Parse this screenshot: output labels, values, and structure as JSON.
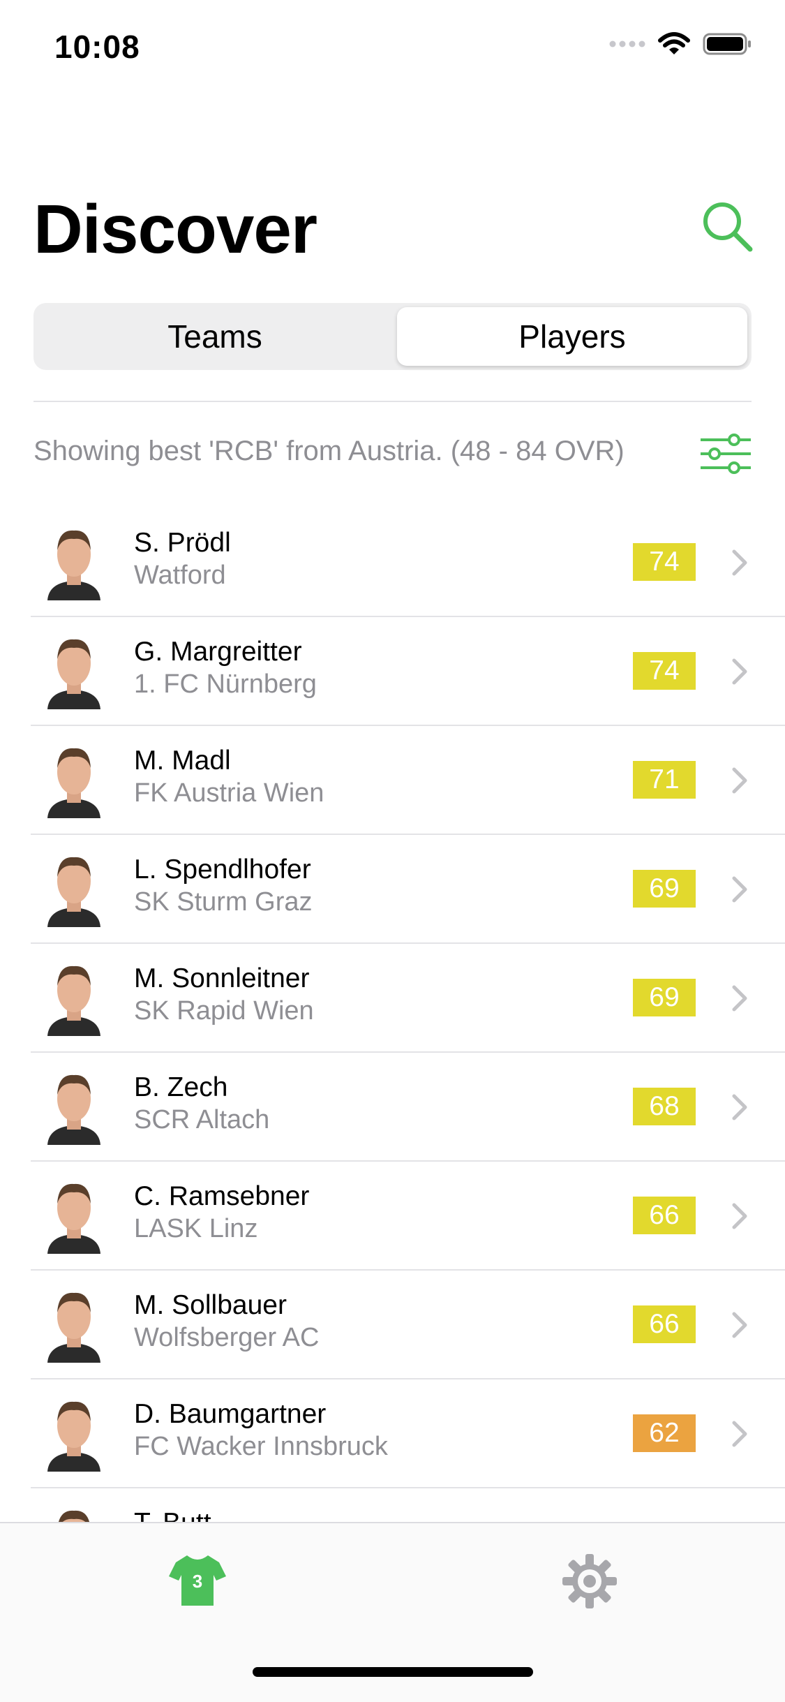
{
  "status_bar": {
    "time": "10:08",
    "icons": [
      "signal-dots-icon",
      "wifi-icon",
      "battery-icon"
    ]
  },
  "header": {
    "title": "Discover",
    "search_icon": "search-icon"
  },
  "segments": {
    "items": [
      "Teams",
      "Players"
    ],
    "selected": "Players"
  },
  "filter": {
    "text": "Showing best 'RCB' from Austria. (48 - 84 OVR)",
    "icon": "sliders-icon"
  },
  "players": [
    {
      "name": "S. Prödl",
      "club": "Watford",
      "rating": "74",
      "rating_color": "#e2d92d"
    },
    {
      "name": "G. Margreitter",
      "club": "1. FC Nürnberg",
      "rating": "74",
      "rating_color": "#e2d92d"
    },
    {
      "name": "M. Madl",
      "club": "FK Austria Wien",
      "rating": "71",
      "rating_color": "#e2d92d"
    },
    {
      "name": "L. Spendlhofer",
      "club": "SK Sturm Graz",
      "rating": "69",
      "rating_color": "#e2d92d"
    },
    {
      "name": "M. Sonnleitner",
      "club": "SK Rapid Wien",
      "rating": "69",
      "rating_color": "#e2d92d"
    },
    {
      "name": "B. Zech",
      "club": "SCR Altach",
      "rating": "68",
      "rating_color": "#e2d92d"
    },
    {
      "name": "C. Ramsebner",
      "club": "LASK Linz",
      "rating": "66",
      "rating_color": "#e2d92d"
    },
    {
      "name": "M. Sollbauer",
      "club": "Wolfsberger AC",
      "rating": "66",
      "rating_color": "#e2d92d"
    },
    {
      "name": "D. Baumgartner",
      "club": "FC Wacker Innsbruck",
      "rating": "62",
      "rating_color": "#eba340"
    },
    {
      "name": "T. Butt...",
      "club": "",
      "rating": "",
      "rating_color": "#e2d92d"
    }
  ],
  "tabbar": {
    "teams_badge": "3",
    "teams_icon": "jersey-icon",
    "settings_icon": "gear-icon"
  },
  "colors": {
    "accent": "#4cbf5a",
    "rating_yellow": "#e2d92d",
    "rating_orange": "#eba340",
    "secondary_text": "#8e8e93"
  }
}
